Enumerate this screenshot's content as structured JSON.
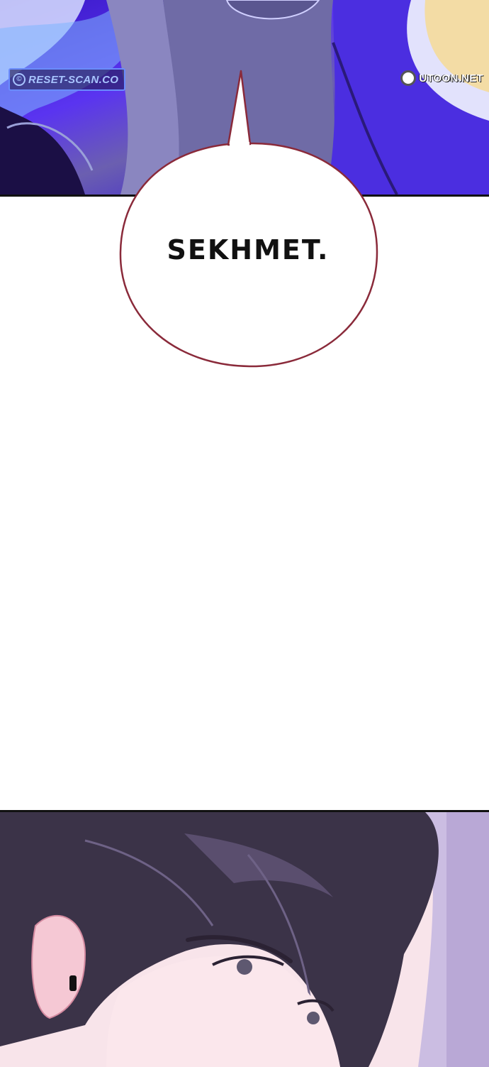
{
  "watermarks": {
    "left": "RESET-SCAN.CO",
    "right": "UTOON.NET"
  },
  "speech_bubble": {
    "text": "SEKHMET."
  },
  "colors": {
    "top_panel_accent": "#4a2ae8",
    "bubble_outline": "#8a2a3a",
    "bottom_panel_skin": "#f7e4ea",
    "hair": "#3b3348"
  }
}
